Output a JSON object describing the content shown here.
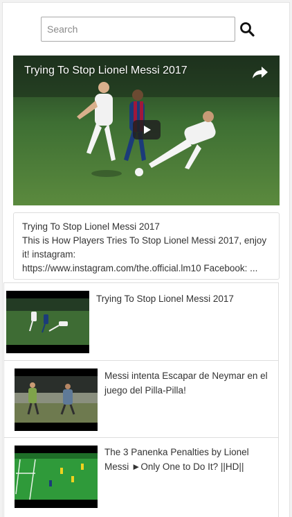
{
  "search": {
    "placeholder": "Search",
    "value": "",
    "icon": "search-icon"
  },
  "player": {
    "title": "Trying To Stop Lionel Messi 2017",
    "share_icon": "share-icon",
    "play_icon": "play-icon"
  },
  "description": {
    "title": "Trying To Stop Lionel Messi 2017",
    "text": "This is How Players Tries To Stop Lionel Messi 2017, enjoy it! instagram:",
    "links": "https://www.instagram.com/the.official.lm10 Facebook: ..."
  },
  "videos": [
    {
      "title": "Trying To Stop Lionel Messi 2017"
    },
    {
      "title": "Messi intenta Escapar de Neymar en el juego del Pilla-Pilla!"
    },
    {
      "title": "The 3 Panenka Penalties by Lionel Messi ►Only One to Do It? ||HD||"
    }
  ],
  "colors": {
    "border": "#dddddd",
    "text": "#333333",
    "pitch": "#3f6b3a"
  }
}
